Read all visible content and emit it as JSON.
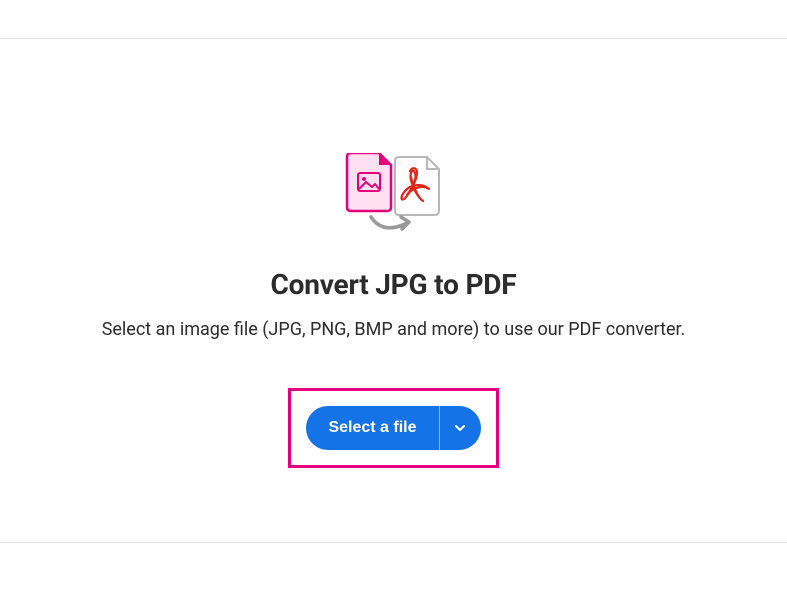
{
  "heading": "Convert JPG to PDF",
  "subheading": "Select an image file (JPG, PNG, BMP and more) to use our PDF converter.",
  "button": {
    "label": "Select a file"
  }
}
